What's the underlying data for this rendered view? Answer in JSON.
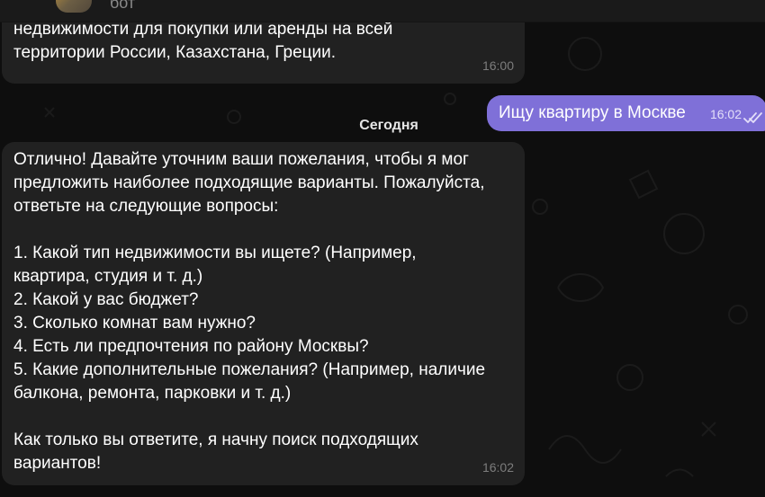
{
  "header": {
    "name": "бот"
  },
  "messages": {
    "first": {
      "text": "Привет. Я бот-риэлтор, я помогу тебе с выбором\nнедвижимости для покупки или аренды на всей\nтерритории России, Казахстана, Греции.",
      "time": "16:00"
    },
    "outgoing": {
      "text": "Ищу квартиру в Москве",
      "time": "16:02"
    },
    "date_separator": "Сегодня",
    "reply": {
      "text": "Отлично! Давайте уточним ваши пожелания, чтобы я мог\nпредложить наиболее подходящие варианты. Пожалуйста,\nответьте на следующие вопросы:\n\n1. Какой тип недвижимости вы ищете? (Например,\nквартира, студия и т. д.)\n2. Какой у вас бюджет?\n3. Сколько комнат вам нужно?\n4. Есть ли предпочтения по району Москвы?\n5. Какие дополнительные пожелания? (Например, наличие\nбалкона, ремонта, парковки и т. д.)\n\nКак только вы ответите, я начну поиск подходящих\nвариантов!",
      "time": "16:02"
    }
  },
  "icons": {
    "read_status": "double-check-icon",
    "avatar": "bot-avatar-icon"
  },
  "colors": {
    "background": "#0e0e0e",
    "incoming_bubble": "#212121",
    "outgoing_bubble": "#7f70d8",
    "timestamp": "#7d7d7d"
  }
}
